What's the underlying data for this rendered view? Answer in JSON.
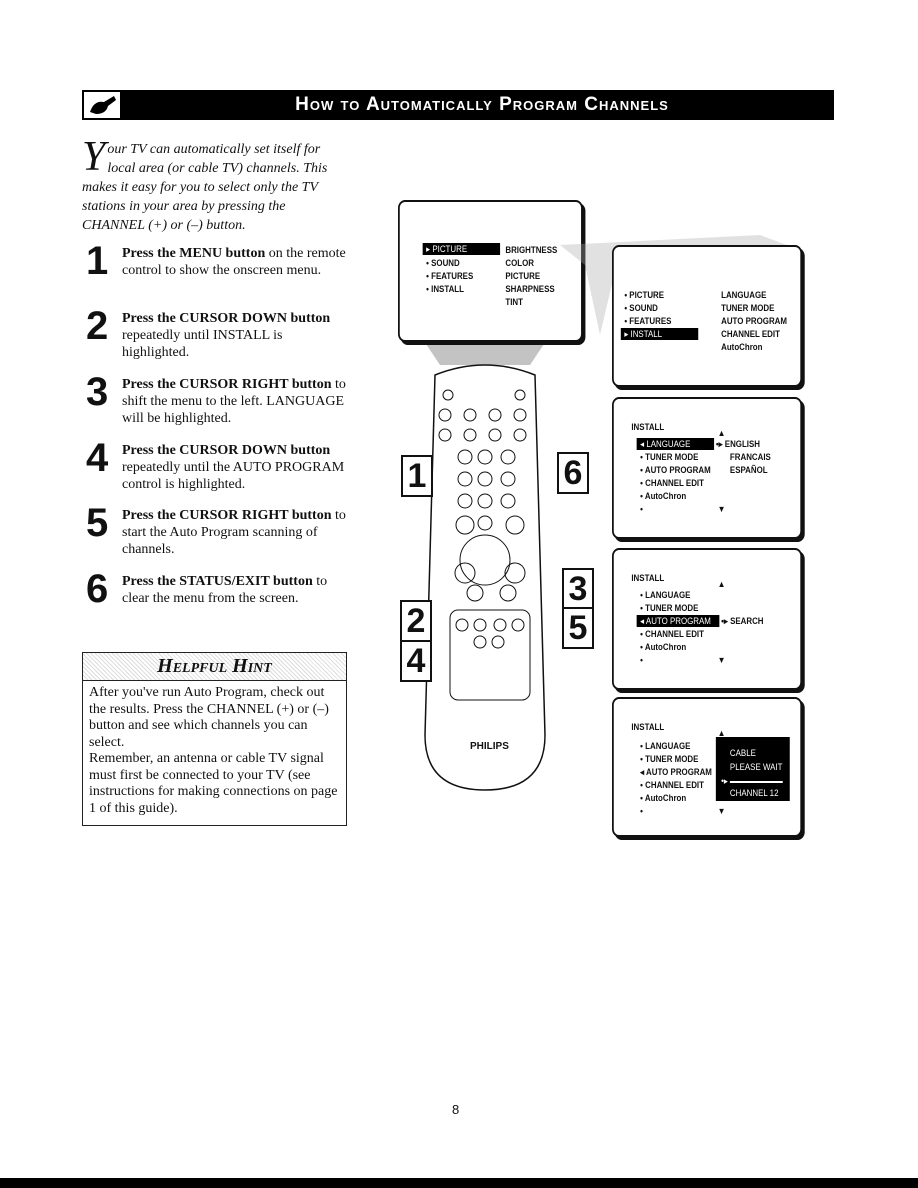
{
  "header": {
    "title": "How to Automatically Program Channels",
    "icon": "remote-hand-icon"
  },
  "intro": {
    "dropcap": "Y",
    "text": "our TV can automatically set itself for local area (or cable TV) channels. This makes it easy for you to select only the TV stations in your area by pressing the CHANNEL (+) or (–) button."
  },
  "steps": [
    {
      "num": "1",
      "bold": "Press the MENU button",
      "rest": " on the remote control to show the onscreen menu."
    },
    {
      "num": "2",
      "bold": "Press the CURSOR DOWN button",
      "rest": " repeatedly until INSTALL is highlighted."
    },
    {
      "num": "3",
      "bold": "Press the CURSOR RIGHT button",
      "rest": " to shift the menu to the left. LANGUAGE will be highlighted."
    },
    {
      "num": "4",
      "bold": "Press the CURSOR DOWN button",
      "rest": " repeatedly until the AUTO PROGRAM control is highlighted."
    },
    {
      "num": "5",
      "bold": "Press the CURSOR RIGHT button",
      "rest": " to start the Auto Program scanning of channels."
    },
    {
      "num": "6",
      "bold": "Press the STATUS/EXIT button",
      "rest": " to clear the menu from the screen."
    }
  ],
  "hint": {
    "title": "Helpful Hint",
    "p1": "After you've run Auto Program, check out the results. Press the CHANNEL (+) or (–) button and see which channels you can select.",
    "p2": "Remember, an antenna or cable TV signal must first be connected to your TV (see instructions for making connections on page 1 of this guide)."
  },
  "screens": {
    "s1": {
      "left": [
        "PICTURE",
        "SOUND",
        "FEATURES",
        "INSTALL"
      ],
      "right": [
        "BRIGHTNESS",
        "COLOR",
        "PICTURE",
        "SHARPNESS",
        "TINT"
      ]
    },
    "s2": {
      "left": [
        "PICTURE",
        "SOUND",
        "FEATURES",
        "INSTALL"
      ],
      "right": [
        "LANGUAGE",
        "TUNER MODE",
        "AUTO PROGRAM",
        "CHANNEL EDIT",
        "AutoChron"
      ]
    },
    "s3": {
      "title": "INSTALL",
      "items": [
        "LANGUAGE",
        "TUNER MODE",
        "AUTO PROGRAM",
        "CHANNEL EDIT",
        "AutoChron"
      ],
      "right": [
        "ENGLISH",
        "FRANCAIS",
        "ESPAÑOL"
      ]
    },
    "s4": {
      "title": "INSTALL",
      "items": [
        "LANGUAGE",
        "TUNER MODE",
        "AUTO PROGRAM",
        "CHANNEL EDIT",
        "AutoChron"
      ],
      "right": "SEARCH"
    },
    "s5": {
      "title": "INSTALL",
      "items": [
        "LANGUAGE",
        "TUNER MODE",
        "AUTO PROGRAM",
        "CHANNEL EDIT",
        "AutoChron"
      ],
      "box": [
        "CABLE",
        "PLEASE WAIT",
        "CHANNEL  12"
      ]
    }
  },
  "callouts": [
    "1",
    "6",
    "2",
    "4",
    "3",
    "5"
  ],
  "remote": {
    "brand": "PHILIPS"
  },
  "page_number": "8"
}
